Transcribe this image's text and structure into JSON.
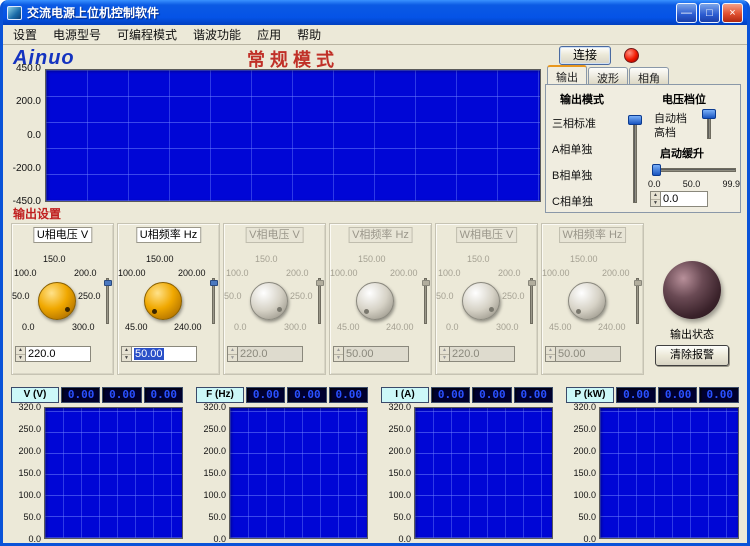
{
  "window": {
    "title": "交流电源上位机控制软件",
    "icons": {
      "minimize": "—",
      "maximize": "□",
      "close": "×",
      "spin_up": "▲",
      "spin_down": "▼"
    }
  },
  "menu": [
    "设置",
    "电源型号",
    "可编程模式",
    "谐波功能",
    "应用",
    "帮助"
  ],
  "header": {
    "brand": "Ainuo",
    "title": "常规模式",
    "connect": "连接"
  },
  "tabs": [
    "输出",
    "波形",
    "相角"
  ],
  "tab_panel": {
    "output_mode": {
      "label": "输出模式",
      "options": [
        "三相标准",
        "A相单独",
        "B相单独",
        "C相单独"
      ],
      "selected": "三相标准"
    },
    "voltage_range": {
      "label": "电压档位",
      "options": [
        "自动档",
        "高档"
      ],
      "selected": "自动档"
    },
    "soft_start": {
      "label": "启动缓升",
      "ticks": [
        "0.0",
        "50.0",
        "99.9"
      ],
      "value": "0.0"
    }
  },
  "top_chart": {
    "yticks": [
      "450.0",
      "200.0",
      "0.0",
      "-200.0",
      "-450.0"
    ]
  },
  "section_label": "输出设置",
  "knobs": [
    {
      "label": "U相电压 V",
      "value": "220.0",
      "enabled": true,
      "selected": false,
      "ticks": [
        "100.0",
        "150.0",
        "200.0",
        "50.0",
        "250.0",
        "0.0",
        "300.0"
      ]
    },
    {
      "label": "U相频率 Hz",
      "value": "50.00",
      "enabled": true,
      "selected": true,
      "ticks": [
        "100.00",
        "150.00",
        "200.00",
        "45.00",
        "240.00"
      ]
    },
    {
      "label": "V相电压 V",
      "value": "220.0",
      "enabled": false,
      "selected": false,
      "ticks": [
        "100.0",
        "150.0",
        "200.0",
        "50.0",
        "250.0",
        "0.0",
        "300.0"
      ]
    },
    {
      "label": "V相频率 Hz",
      "value": "50.00",
      "enabled": false,
      "selected": false,
      "ticks": [
        "100.00",
        "150.00",
        "200.00",
        "45.00",
        "240.00"
      ]
    },
    {
      "label": "W相电压 V",
      "value": "220.0",
      "enabled": false,
      "selected": false,
      "ticks": [
        "100.0",
        "150.0",
        "200.0",
        "50.0",
        "250.0",
        "0.0",
        "300.0"
      ]
    },
    {
      "label": "W相频率 Hz",
      "value": "50.00",
      "enabled": false,
      "selected": false,
      "ticks": [
        "100.00",
        "150.00",
        "200.00",
        "45.00",
        "240.00"
      ]
    }
  ],
  "output_status": {
    "label": "输出状态",
    "clear_button": "清除报警"
  },
  "meters": [
    {
      "label": "V (V)",
      "values": [
        "0.00",
        "0.00",
        "0.00"
      ]
    },
    {
      "label": "F (Hz)",
      "values": [
        "0.00",
        "0.00",
        "0.00"
      ]
    },
    {
      "label": "I (A)",
      "values": [
        "0.00",
        "0.00",
        "0.00"
      ]
    },
    {
      "label": "P (kW)",
      "values": [
        "0.00",
        "0.00",
        "0.00"
      ]
    }
  ],
  "bottom_chart": {
    "yticks": [
      "320.0",
      "250.0",
      "200.0",
      "150.0",
      "100.0",
      "50.0",
      "0.0"
    ]
  },
  "colors": {
    "chart_bg": "#0006d6",
    "led_red": "#f01800",
    "knob_gold": "#f0a800",
    "meter_text": "#2a50ff",
    "title_red": "#c03028",
    "brand_blue": "#1433c0"
  }
}
